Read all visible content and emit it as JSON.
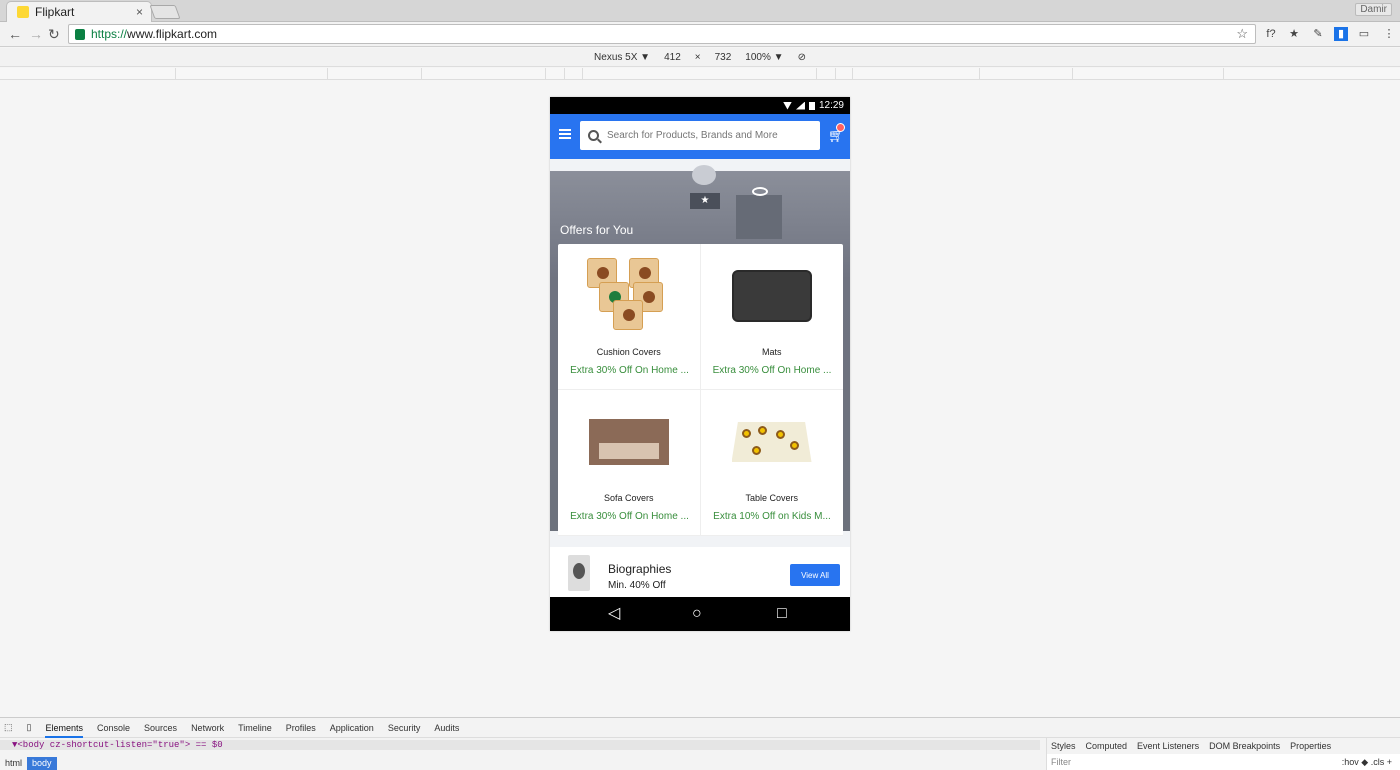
{
  "browser": {
    "tab_title": "Flipkart",
    "tab_close": "×",
    "profile_label": "Damir",
    "url_scheme": "https://",
    "url_host": "www.flipkart.com",
    "device_name": "Nexus 5X",
    "device_width": "412",
    "device_x": "×",
    "device_height": "732",
    "zoom": "100%",
    "ext_icons": [
      "f?",
      "star-icon",
      "pen-icon",
      "chart-icon",
      "cast-icon",
      "menu-icon"
    ]
  },
  "phone": {
    "time": "12:29",
    "search_placeholder": "Search for Products, Brands and More",
    "offers_title": "Offers for You",
    "offers": [
      {
        "name": "Cushion Covers",
        "discount": "Extra 30% Off On Home ..."
      },
      {
        "name": "Mats",
        "discount": "Extra 30% Off On Home ..."
      },
      {
        "name": "Sofa Covers",
        "discount": "Extra 30% Off On Home ..."
      },
      {
        "name": "Table Covers",
        "discount": "Extra 10% Off on Kids M..."
      }
    ],
    "bio_title": "Biographies",
    "bio_subtitle": "Min. 40% Off",
    "view_all": "View All"
  },
  "devtools": {
    "tabs": [
      "Elements",
      "Console",
      "Sources",
      "Network",
      "Timeline",
      "Profiles",
      "Application",
      "Security",
      "Audits"
    ],
    "active_tab": "Elements",
    "code_line": "▼<body cz-shortcut-listen=\"true\"> == $0",
    "breadcrumb": [
      "html",
      "body"
    ],
    "side_tabs": [
      "Styles",
      "Computed",
      "Event Listeners",
      "DOM Breakpoints",
      "Properties"
    ],
    "filter_placeholder": "Filter",
    "filter_right": ":hov  ◆  .cls  +"
  },
  "colors": {
    "brand_blue": "#2874f0",
    "discount_green": "#388e3c"
  }
}
